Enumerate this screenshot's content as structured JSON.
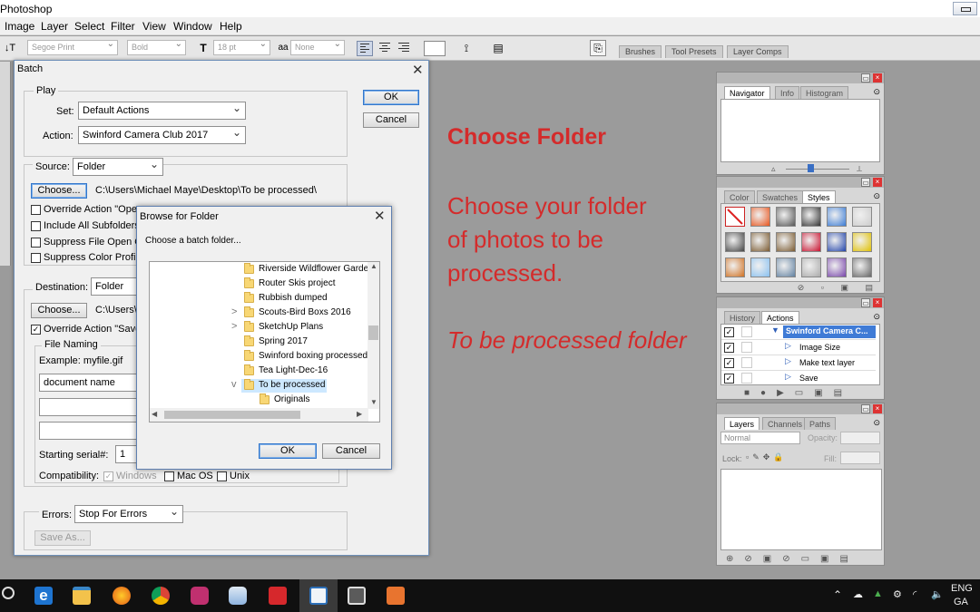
{
  "app": {
    "title": "Photoshop",
    "menu": [
      "Image",
      "Layer",
      "Select",
      "Filter",
      "View",
      "Window",
      "Help"
    ]
  },
  "options_bar": {
    "font_family": "Segoe Print",
    "font_style": "Bold",
    "font_size": "18 pt",
    "antialias": "None",
    "panel_tabs": [
      "Brushes",
      "Tool Presets",
      "Layer Comps"
    ]
  },
  "overlay_text": {
    "heading": "Choose Folder",
    "body_lines": [
      "Choose your folder",
      "of photos to be",
      "processed."
    ],
    "note": "To be processed folder",
    "color": "#d42b2b"
  },
  "batch_dialog": {
    "title": "Batch",
    "ok": "OK",
    "cancel": "Cancel",
    "play": {
      "group": "Play",
      "set_label": "Set:",
      "set_value": "Default Actions",
      "action_label": "Action:",
      "action_value": "Swinford Camera Club 2017"
    },
    "source": {
      "label": "Source:",
      "value": "Folder",
      "choose": "Choose...",
      "path": "C:\\Users\\Michael Maye\\Desktop\\To be processed\\",
      "options": [
        {
          "label": "Override Action \"Ope",
          "checked": false
        },
        {
          "label": "Include All Subfolders",
          "checked": false
        },
        {
          "label": "Suppress File Open O",
          "checked": false
        },
        {
          "label": "Suppress Color Profile",
          "checked": false
        }
      ]
    },
    "destination": {
      "label": "Destination:",
      "value": "Folder",
      "choose": "Choose...",
      "path": "C:\\Users\\",
      "override": {
        "label": "Override Action \"Save",
        "checked": true
      },
      "file_naming": "File Naming",
      "example": "Example: myfile.gif",
      "name_field": "document name",
      "starting_serial_label": "Starting serial#:",
      "starting_serial": "1",
      "compat_label": "Compatibility:",
      "compat": [
        {
          "label": "Windows",
          "checked": true,
          "disabled": true
        },
        {
          "label": "Mac OS",
          "checked": false,
          "disabled": false
        },
        {
          "label": "Unix",
          "checked": false,
          "disabled": false
        }
      ]
    },
    "errors": {
      "label": "Errors:",
      "value": "Stop For Errors",
      "save_as": "Save As..."
    }
  },
  "browse_dialog": {
    "title": "Browse for Folder",
    "prompt": "Choose a batch folder...",
    "folders": [
      {
        "name": "Riverside Wildflower Garden",
        "expander": "",
        "level": 0
      },
      {
        "name": "Router Skis project",
        "expander": "",
        "level": 0
      },
      {
        "name": "Rubbish dumped",
        "expander": "",
        "level": 0
      },
      {
        "name": "Scouts-Bird Boxs 2016",
        "expander": ">",
        "level": 0
      },
      {
        "name": "SketchUp Plans",
        "expander": ">",
        "level": 0
      },
      {
        "name": "Spring 2017",
        "expander": "",
        "level": 0
      },
      {
        "name": "Swinford boxing processed",
        "expander": "",
        "level": 0
      },
      {
        "name": "Tea Light-Dec-16",
        "expander": "",
        "level": 0
      },
      {
        "name": "To be processed",
        "expander": "v",
        "level": 0,
        "selected": true
      },
      {
        "name": "Originals",
        "expander": "",
        "level": 1
      }
    ],
    "ok": "OK",
    "cancel": "Cancel"
  },
  "panels": {
    "navigator": {
      "tabs": [
        "Navigator",
        "Info",
        "Histogram"
      ],
      "active": 0
    },
    "styles": {
      "tabs": [
        "Color",
        "Swatches",
        "Styles"
      ],
      "active": 2,
      "swatches": [
        "#ffffff",
        "#e8541c",
        "#555555",
        "#333333",
        "#3a7bd5",
        "#cccccc",
        "#444444",
        "#7a5a30",
        "#7a5a30",
        "#c8102e",
        "#2244aa",
        "#e0c000",
        "#d07020",
        "#88c0f0",
        "#6080a0",
        "#aaaaaa",
        "#7744aa",
        "#666666"
      ]
    },
    "actions": {
      "tabs": [
        "History",
        "Actions"
      ],
      "active": 1,
      "items": [
        {
          "label": "Swinford Camera C...",
          "highlight": true
        },
        {
          "label": "Image Size",
          "highlight": false
        },
        {
          "label": "Make text layer",
          "highlight": false
        },
        {
          "label": "Save",
          "highlight": false
        }
      ]
    },
    "layers": {
      "tabs": [
        "Layers",
        "Channels",
        "Paths"
      ],
      "active": 0,
      "blend_mode": "Normal",
      "opacity_label": "Opacity:",
      "lock_label": "Lock:",
      "fill_label": "Fill:"
    }
  },
  "taskbar": {
    "lang_top": "ENG",
    "lang_bottom": "GA",
    "icons": [
      "search-icon",
      "edge-icon",
      "file-explorer-icon",
      "firefox-icon",
      "chrome-icon",
      "winamp-icon",
      "paint-icon",
      "sketchup-icon",
      "photoshop-icon",
      "app-icon-1",
      "app-icon-2"
    ]
  }
}
